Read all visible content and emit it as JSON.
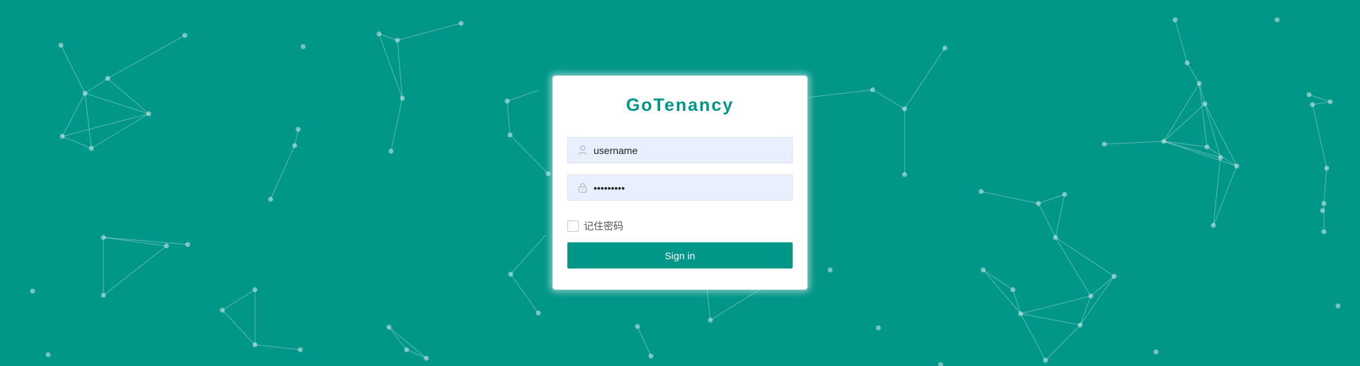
{
  "colors": {
    "accent": "#009688",
    "input_bg": "#e8f0fe"
  },
  "brand": {
    "title": "GoTenancy"
  },
  "form": {
    "username": {
      "value": "username",
      "icon": "user-icon"
    },
    "password": {
      "value": "123456789",
      "icon": "lock-icon"
    },
    "remember_label": "记住密码",
    "remember_checked": false,
    "signin_label": "Sign in"
  }
}
